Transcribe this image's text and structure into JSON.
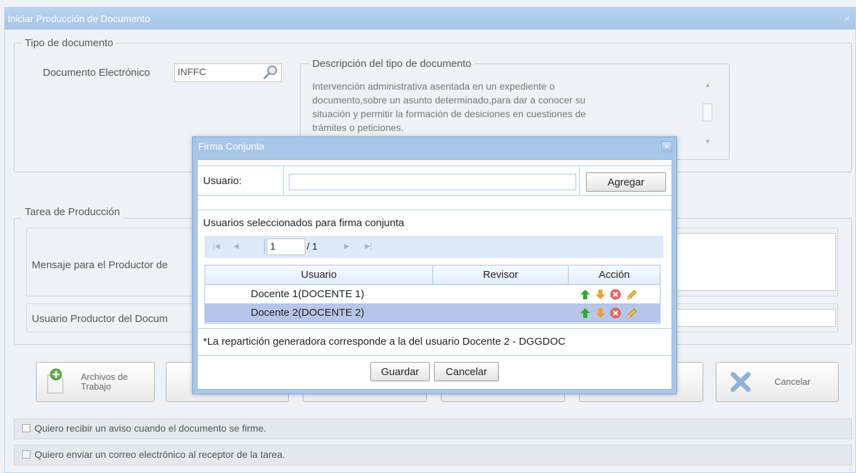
{
  "main": {
    "title": "Iniciar Producción de Documento",
    "tipo_documento": {
      "legend": "Tipo de documento",
      "doc_electronico_label": "Documento Electrónico",
      "doc_electronico_value": "INFFC",
      "descripcion_legend": "Descripción del tipo de documento",
      "descripcion_lines": [
        "Intervención administrativa asentada en un expediente o",
        "documento,sobre un asunto determinado,para dar a conocer su",
        "situación y permitir la formación de desiciones en cuestiones de",
        "trámites o peticiones."
      ]
    },
    "tarea": {
      "legend": "Tarea de Producción",
      "mensaje_label": "Mensaje para el Productor de",
      "usuario_productor_label": "Usuario Productor del Docum"
    },
    "buttons": {
      "archivos_line1": "Archivos de",
      "archivos_line2": "Trabajo",
      "cancelar": "Cancelar"
    },
    "checkboxes": [
      "Quiero recibir un aviso cuando el documento se firme.",
      "Quiero enviar un correo electrónico al receptor de la tarea."
    ]
  },
  "dialog": {
    "title": "Firma Conjunta",
    "usuario_label": "Usuario:",
    "usuario_value": "",
    "agregar": "Agregar",
    "seleccionados_title": "Usuarios seleccionados para firma conjunta",
    "pager": {
      "page": "1",
      "of": "/ 1"
    },
    "columns": [
      "Usuario",
      "Revisor",
      "Acción"
    ],
    "rows": [
      {
        "usuario": "Docente 1(DOCENTE 1)",
        "revisor": ""
      },
      {
        "usuario": "Docente 2(DOCENTE 2)",
        "revisor": ""
      }
    ],
    "note": "*La repartición generadora corresponde a la del usuario Docente 2 - DGGDOC",
    "guardar": "Guardar",
    "cancelar": "Cancelar"
  },
  "colors": {
    "titlebar": "#a8c7e8",
    "selected_row": "#b7c6e6",
    "arrow_up": "#3aa53a",
    "arrow_down": "#f0a030",
    "delete": "#e05a5a",
    "edit": "#e8b040"
  }
}
